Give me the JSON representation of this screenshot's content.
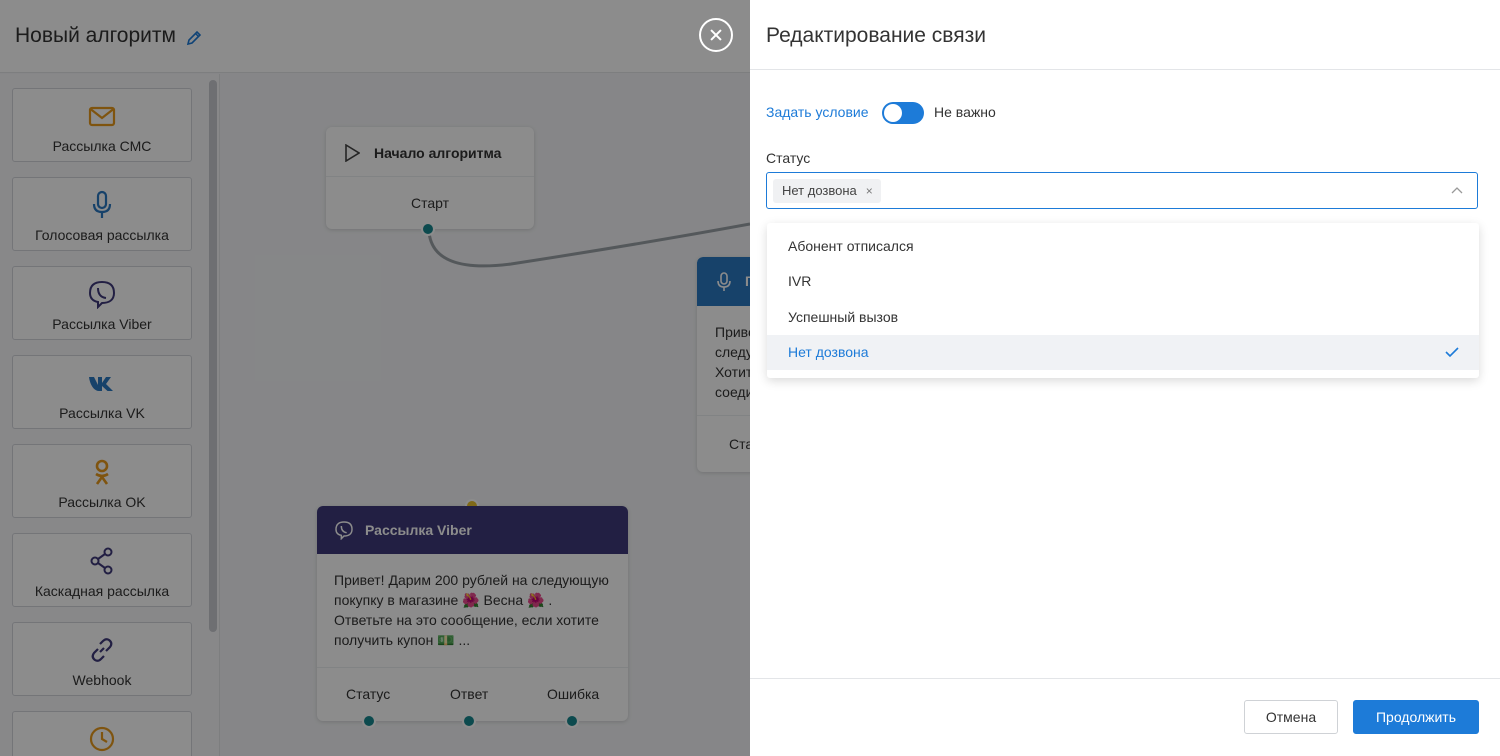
{
  "app": {
    "title": "Новый алгоритм",
    "palette": [
      {
        "label": "Рассылка СМС",
        "icon": "envelope-icon"
      },
      {
        "label": "Голосовая рассылка",
        "icon": "microphone-icon"
      },
      {
        "label": "Рассылка Viber",
        "icon": "viber-icon"
      },
      {
        "label": "Рассылка VK",
        "icon": "vk-icon"
      },
      {
        "label": "Рассылка OK",
        "icon": "odnoklassniki-icon"
      },
      {
        "label": "Каскадная рассылка",
        "icon": "share-icon"
      },
      {
        "label": "Webhook",
        "icon": "link-icon"
      },
      {
        "label": "",
        "icon": "clock-icon"
      }
    ],
    "start_node": {
      "title": "Начало алгоритма",
      "body": "Старт"
    },
    "voice_node": {
      "title": "Г",
      "body_lines": [
        "Приве",
        "следу",
        "Хотит",
        "соеди"
      ],
      "footer": "Ста"
    },
    "viber_node": {
      "title": "Рассылка Viber",
      "body": "Привет! Дарим 200 рублей на следующую покупку в магазине 🌺 Весна 🌺 . Ответьте на это сообщение, если хотите получить купон 💵 ...",
      "outputs": [
        "Статус",
        "Ответ",
        "Ошибка"
      ]
    }
  },
  "drawer": {
    "title": "Редактирование связи",
    "condition_link": "Задать условие",
    "toggle_text": "Не важно",
    "status_label": "Статус",
    "selected_chip": "Нет дозвона",
    "chip_remove": "×",
    "options": [
      {
        "label": "Абонент отписался",
        "selected": false
      },
      {
        "label": "IVR",
        "selected": false
      },
      {
        "label": "Успешный вызов",
        "selected": false
      },
      {
        "label": "Нет дозвона",
        "selected": true
      }
    ],
    "cancel_label": "Отмена",
    "continue_label": "Продолжить"
  },
  "colors": {
    "accent": "#1d7bd8",
    "palette_icon": "#e89a1c",
    "viber_header": "#3f3a7a",
    "voice_header": "#2b78c2",
    "port": "#17888f"
  }
}
